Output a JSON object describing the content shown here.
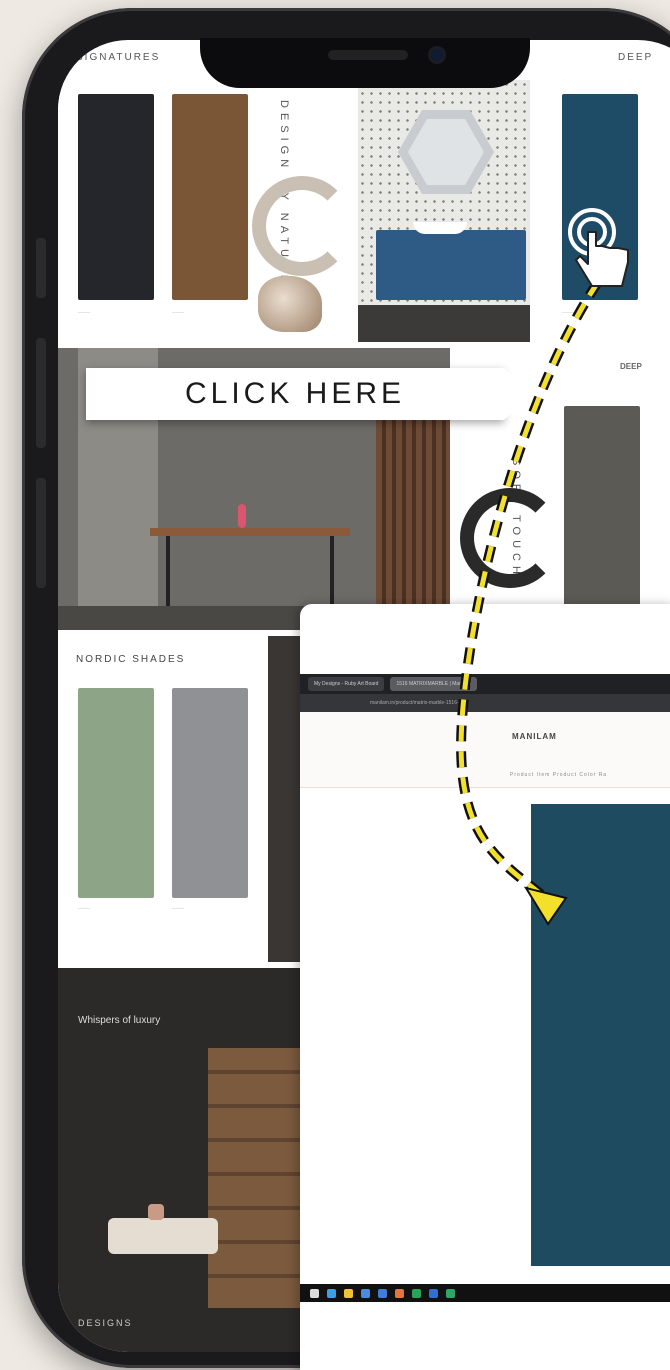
{
  "cta": {
    "label": "CLICK HERE"
  },
  "catalog": {
    "top_header": "SIGNATURES",
    "top_right_tag": "DEEP",
    "panel_right_tag": "DEEP",
    "mid_header": "NORDIC SHADES",
    "vertical_text_top": "DESIGN BY NATURE",
    "vertical_text_mid": "SOFT TOUCH",
    "bottom_caption": "Whispers of luxury",
    "bottom_footer": "DESIGNS",
    "colors": {
      "charcoal": "#24262c",
      "walnut": "#7a5636",
      "teal": "#1e4b66",
      "graphite": "#5c5a55",
      "sage": "#8ea486",
      "slate": "#8f9194"
    }
  },
  "browser": {
    "tabs": [
      "My Designs - Ruby Art Board",
      "1516 MATRIXMARBLE | Manilam"
    ],
    "url": "manilam.in/product/matrix-marble-1516-sn",
    "brand": "MANILAM",
    "nav": "Product Item   Product Color   Ra",
    "swatch_color": "#1e4b60"
  },
  "icons": [
    "tap-hand-icon",
    "dashed-arrow-icon"
  ]
}
